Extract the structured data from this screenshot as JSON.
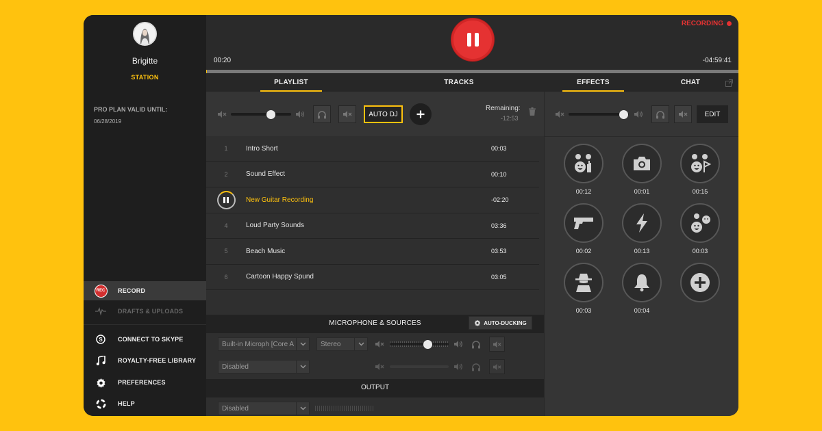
{
  "user": {
    "name": "Brigitte",
    "role": "STATION"
  },
  "plan": {
    "label": "PRO PLAN VALID UNTIL:",
    "date": "06/28/2019"
  },
  "sidebar": {
    "items": [
      {
        "label": "RECORD",
        "icon": "rec-icon",
        "active": true
      },
      {
        "label": "DRAFTS & UPLOADS",
        "icon": "waveform-icon",
        "dim": true
      },
      {
        "label": "CONNECT TO SKYPE",
        "icon": "skype-icon"
      },
      {
        "label": "ROYALTY-FREE LIBRARY",
        "icon": "music-note-icon"
      },
      {
        "label": "PREFERENCES",
        "icon": "gear-icon"
      },
      {
        "label": "HELP",
        "icon": "help-ring-icon"
      }
    ],
    "rec_badge": "REC"
  },
  "player": {
    "status": "RECORDING",
    "elapsed": "00:20",
    "remaining": "-04:59:41",
    "progress": 0.001
  },
  "tabs": {
    "left": [
      "PLAYLIST",
      "TRACKS"
    ],
    "right": [
      "EFFECTS",
      "CHAT"
    ]
  },
  "playlist_controls": {
    "auto_dj": "AUTO DJ",
    "remaining_label": "Remaining:",
    "remaining_value": "-12:53",
    "volume": 0.66
  },
  "effects_controls": {
    "edit": "EDIT",
    "volume": 0.92
  },
  "tracks": [
    {
      "num": "1",
      "title": "Intro Short",
      "time": "00:03"
    },
    {
      "num": "2",
      "title": "Sound Effect",
      "time": "00:10"
    },
    {
      "num": "",
      "title": "New Guitar Recording",
      "time": "-02:20",
      "playing": true
    },
    {
      "num": "4",
      "title": "Loud Party Sounds",
      "time": "03:36"
    },
    {
      "num": "5",
      "title": "Beach Music",
      "time": "03:53"
    },
    {
      "num": "6",
      "title": "Cartoon Happy Spund",
      "time": "03:05"
    }
  ],
  "microphone": {
    "title": "MICROPHONE & SOURCES",
    "auto_ducking": "AUTO-DUCKING",
    "source1": "Built-in Microph [Core A",
    "channel": "Stereo",
    "source2": "Disabled"
  },
  "output": {
    "title": "OUTPUT",
    "device": "Disabled"
  },
  "effects": [
    {
      "icon": "applause-icon",
      "time": "00:12"
    },
    {
      "icon": "camera-icon",
      "time": "00:01"
    },
    {
      "icon": "celebration-icon",
      "time": "00:15"
    },
    {
      "icon": "gun-icon",
      "time": "00:02"
    },
    {
      "icon": "lightning-icon",
      "time": "00:13"
    },
    {
      "icon": "laughter-icon",
      "time": "00:03"
    },
    {
      "icon": "spy-icon",
      "time": "00:03"
    },
    {
      "icon": "bell-icon",
      "time": "00:04"
    },
    {
      "icon": "add-effect-icon",
      "time": ""
    }
  ],
  "colors": {
    "accent": "#FFC20E",
    "record": "#E53232",
    "background": "#FFC20E"
  }
}
